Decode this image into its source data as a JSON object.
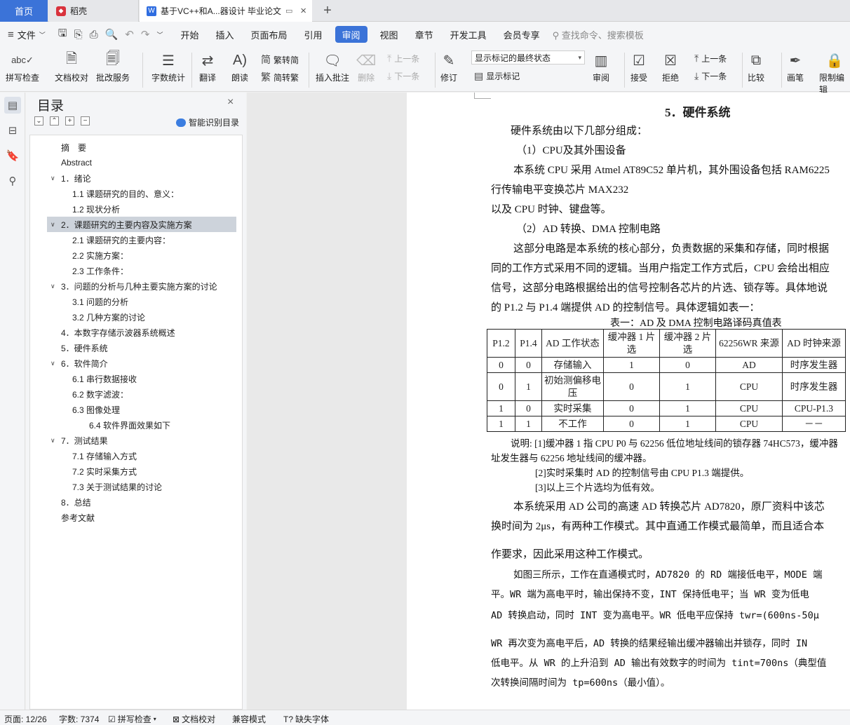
{
  "tabs": {
    "home": "首页",
    "daoke": "稻壳",
    "doc": "基于VC++和A...器设计 毕业论文"
  },
  "menubar": {
    "file": "文件",
    "items": [
      "开始",
      "插入",
      "页面布局",
      "引用",
      "审阅",
      "视图",
      "章节",
      "开发工具",
      "会员专享"
    ],
    "active": "审阅",
    "search": "查找命令、搜索模板"
  },
  "ribbon": {
    "spell": "拼写检查",
    "proof": "文档校对",
    "review_service": "批改服务",
    "word_count": "字数统计",
    "translate": "翻译",
    "read": "朗读",
    "trad": "繁转简",
    "simp": "简转繁",
    "insert_comment": "插入批注",
    "delete": "删除",
    "prev": "上一条",
    "next": "下一条",
    "track": "修订",
    "markup_combo": "显示标记的最终状态",
    "show_markup": "显示标记",
    "review_pane": "审阅",
    "accept": "接受",
    "reject": "拒绝",
    "prev2": "上一条",
    "next2": "下一条",
    "compare": "比较",
    "pen": "画笔",
    "restrict": "限制编辑"
  },
  "toc": {
    "title": "目录",
    "smart": "智能识别目录",
    "items": [
      {
        "text": "摘　要",
        "level": 0
      },
      {
        "text": "Abstract",
        "level": 0
      },
      {
        "text": "1．绪论",
        "level": 1
      },
      {
        "text": "1.1 课题研究的目的、意义：",
        "level": 2
      },
      {
        "text": "1.2 现状分析",
        "level": 2
      },
      {
        "text": "2．课题研究的主要内容及实施方案",
        "level": 1,
        "selected": true
      },
      {
        "text": "2.1 课题研究的主要内容：",
        "level": 2
      },
      {
        "text": "2.2 实施方案：",
        "level": 2
      },
      {
        "text": "2.3 工作条件：",
        "level": 2
      },
      {
        "text": "3．问题的分析与几种主要实施方案的讨论",
        "level": 1
      },
      {
        "text": "3.1 问题的分析",
        "level": 2
      },
      {
        "text": "3.2 几种方案的讨论",
        "level": 2
      },
      {
        "text": "4．本数字存储示波器系统概述",
        "level": 0
      },
      {
        "text": "5．硬件系统",
        "level": 0
      },
      {
        "text": "6．软件简介",
        "level": 1
      },
      {
        "text": "6.1 串行数据接收",
        "level": 2
      },
      {
        "text": "6.2 数字滤波：",
        "level": 2
      },
      {
        "text": "6.3 图像处理",
        "level": 2
      },
      {
        "text": "6.4 软件界面效果如下",
        "level": 3
      },
      {
        "text": "7．测试结果",
        "level": 1
      },
      {
        "text": "7.1 存储输入方式",
        "level": 2
      },
      {
        "text": "7.2 实时采集方式",
        "level": 2
      },
      {
        "text": "7.3 关于测试结果的讨论",
        "level": 2
      },
      {
        "text": "8．总结",
        "level": 0
      },
      {
        "text": "参考文献",
        "level": 0
      }
    ]
  },
  "doc": {
    "heading": "5．硬件系统",
    "lines": [
      "硬件系统由以下几部分组成：",
      "（1）CPU及其外围设备",
      "本系统 CPU 采用 Atmel AT89C52 单片机，其外围设备包括 RAM6225",
      "行传输电平变换芯片 MAX232",
      "以及 CPU 时钟、键盘等。",
      "（2）AD 转换、DMA 控制电路",
      "这部分电路是本系统的核心部分，负责数据的采集和存储，同时根据",
      "同的工作方式采用不同的逻辑。当用户指定工作方式后，CPU 会给出相应",
      "信号，这部分电路根据给出的信号控制各芯片的片选、锁存等。具体地说",
      "的 P1.2 与 P1.4 端提供 AD 的控制信号。具体逻辑如表一："
    ],
    "table_caption": "表一：AD 及 DMA 控制电路译码真值表",
    "table_header": [
      "P1.2",
      "P1.4",
      "AD 工作状态",
      "缓冲器 1 片选",
      "缓冲器 2 片选",
      "62256WR 来源",
      "AD 时钟来源"
    ],
    "table_rows": [
      [
        "0",
        "0",
        "存储输入",
        "1",
        "0",
        "AD",
        "时序发生器"
      ],
      [
        "0",
        "1",
        "初始测偏移电压",
        "0",
        "1",
        "CPU",
        "时序发生器"
      ],
      [
        "1",
        "0",
        "实时采集",
        "0",
        "1",
        "CPU",
        "CPU-P1.3"
      ],
      [
        "1",
        "1",
        "不工作",
        "0",
        "1",
        "CPU",
        "－－"
      ]
    ],
    "notes": [
      "说明: [1]缓冲器 1 指 CPU P0 与 62256 低位地址线间的锁存器 74HC573，缓冲器",
      "址发生器与 62256 地址线间的缓冲器。",
      "[2]实时采集时 AD 的控制信号由 CPU P1.3 端提供。",
      "[3]以上三个片选均为低有效。"
    ],
    "lines2": [
      "本系统采用 AD 公司的高速 AD 转换芯片 AD7820，原厂资料中该芯",
      "换时间为 2μs，有两种工作模式。其中直通工作模式最简单，而且适合本",
      "作要求，因此采用这种工作模式。",
      "如图三所示，工作在直通模式时，AD7820 的 RD 端接低电平，MODE 端",
      "平。WR 端为高电平时，输出保持不变，INT 保持低电平；当 WR 变为低电",
      "AD 转换启动，同时 INT 变为高电平。WR 低电平应保持 twr=(600ns-50μ",
      "WR 再次变为高电平后，AD 转换的结果经输出缓冲器输出并锁存，同时 IN",
      "低电平。从 WR 的上升沿到 AD 输出有效数字的时间为 tint=700ns（典型值",
      "次转换间隔时间为 tp=600ns（最小值）。"
    ]
  },
  "status": {
    "page": "页面: 12/26",
    "words": "字数: 7374",
    "spell": "拼写检查",
    "proof": "文档校对",
    "compat": "兼容模式",
    "font": "缺失字体"
  }
}
